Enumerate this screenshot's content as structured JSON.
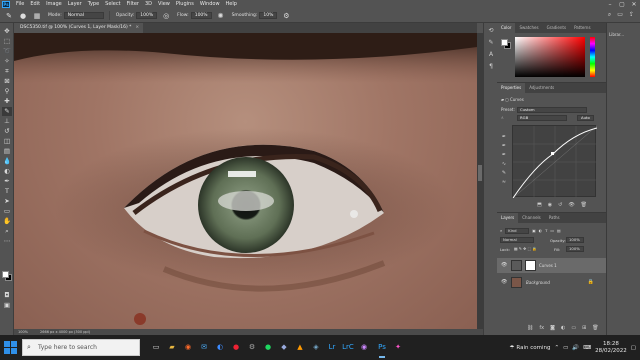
{
  "menubar": {
    "logo": "Ps",
    "items": [
      "File",
      "Edit",
      "Image",
      "Layer",
      "Type",
      "Select",
      "Filter",
      "3D",
      "View",
      "Plugins",
      "Window",
      "Help"
    ]
  },
  "options": {
    "mode_label": "Mode:",
    "mode_value": "Normal",
    "opacity_label": "Opacity:",
    "opacity_value": "100%",
    "flow_label": "Flow:",
    "flow_value": "100%",
    "smoothing_label": "Smoothing:",
    "smoothing_value": "10%"
  },
  "document": {
    "tab_title": "DSC5350.tif @ 100% (Curves 1, Layer Mask/16) *",
    "zoom": "100%",
    "doc_info": "2666 px x 4000 px (300 ppi)"
  },
  "color_panel": {
    "tabs": [
      "Color",
      "Swatches",
      "Gradients",
      "Patterns"
    ],
    "active_tab": "Color"
  },
  "properties_panel": {
    "tabs": [
      "Properties",
      "Adjustments"
    ],
    "adjustment_title": "Curves",
    "preset_label": "Preset:",
    "preset_value": "Custom",
    "channel_value": "RGB",
    "auto_label": "Auto"
  },
  "layers_panel": {
    "tabs": [
      "Layers",
      "Channels",
      "Paths"
    ],
    "kind_label": "Kind",
    "blend_mode": "Normal",
    "opacity_label": "Opacity:",
    "opacity_value": "100%",
    "lock_label": "Lock:",
    "fill_label": "Fill:",
    "fill_value": "100%",
    "layers": [
      {
        "name": "Curves 1",
        "selected": true
      },
      {
        "name": "Background",
        "selected": false
      }
    ]
  },
  "libraries": {
    "label": "Librar..."
  },
  "taskbar": {
    "search_placeholder": "Type here to search",
    "weather_text": "Rain coming",
    "time": "18:28",
    "date": "28/02/2022"
  },
  "colors": {
    "ui_bg": "#535353",
    "ui_dark": "#424242",
    "accent": "#31a8ff",
    "taskbar": "#202020"
  }
}
